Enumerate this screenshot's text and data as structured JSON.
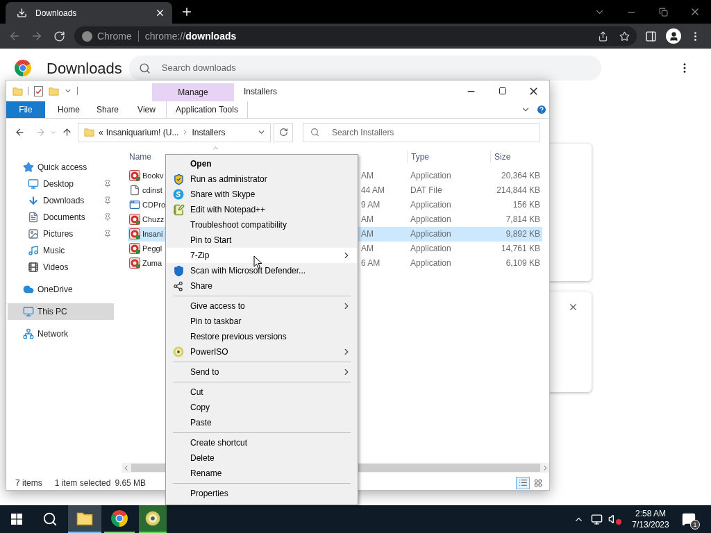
{
  "chrome": {
    "tab": {
      "title": "Downloads"
    },
    "omnibox": {
      "site": "Chrome",
      "url": "chrome://**downloads**"
    }
  },
  "downloads_page": {
    "title": "Downloads",
    "search": {
      "placeholder": "Search downloads"
    },
    "cards": [
      {
        "closable": false
      },
      {
        "closable": true
      }
    ]
  },
  "explorer": {
    "title": "Installers",
    "context_tab": "Manage",
    "ribbon_tabs": [
      {
        "label": "File",
        "kind": "file"
      },
      {
        "label": "Home",
        "kind": "tab"
      },
      {
        "label": "Share",
        "kind": "tab"
      },
      {
        "label": "View",
        "kind": "tab"
      },
      {
        "label": "Application Tools",
        "kind": "context"
      }
    ],
    "address": {
      "overflow": "«",
      "segments": [
        "Insaniquarium! (U...",
        "Installers"
      ]
    },
    "search": {
      "placeholder": "Search Installers"
    },
    "nav": [
      {
        "label": "Quick access",
        "kind": "star",
        "selected": false,
        "children": [
          {
            "label": "Desktop",
            "kind": "desktop",
            "pinned": true,
            "selected": false
          },
          {
            "label": "Downloads",
            "kind": "downloads",
            "pinned": true,
            "selected": false
          },
          {
            "label": "Documents",
            "kind": "documents",
            "pinned": true,
            "selected": false
          },
          {
            "label": "Pictures",
            "kind": "pictures",
            "pinned": true,
            "selected": false
          },
          {
            "label": "Music",
            "kind": "music",
            "pinned": false,
            "selected": false
          },
          {
            "label": "Videos",
            "kind": "videos",
            "pinned": false,
            "selected": false
          }
        ]
      },
      {
        "label": "OneDrive",
        "kind": "cloud",
        "selected": false
      },
      {
        "label": "This PC",
        "kind": "pc",
        "selected": true
      },
      {
        "label": "Network",
        "kind": "network",
        "selected": false
      }
    ],
    "columns": [
      {
        "label": "Name"
      },
      {
        "label": "Type"
      },
      {
        "label": "Size"
      }
    ],
    "files": [
      {
        "kind": "app",
        "name": "Bookv",
        "date": "AM",
        "type": "Application",
        "size": "20,364 KB",
        "selected": false
      },
      {
        "kind": "file",
        "name": "cdinst",
        "date": "44 AM",
        "type": "DAT File",
        "size": "214,844 KB",
        "selected": false
      },
      {
        "kind": "window",
        "name": "CDPro",
        "date": "9 AM",
        "type": "Application",
        "size": "156 KB",
        "selected": false
      },
      {
        "kind": "app",
        "name": "Chuzz",
        "date": "AM",
        "type": "Application",
        "size": "7,814 KB",
        "selected": false
      },
      {
        "kind": "app",
        "name": "Insani",
        "date": "AM",
        "type": "Application",
        "size": "9,892 KB",
        "selected": true
      },
      {
        "kind": "app",
        "name": "Peggl",
        "date": "AM",
        "type": "Application",
        "size": "14,761 KB",
        "selected": false
      },
      {
        "kind": "app",
        "name": "Zuma",
        "date": "6 AM",
        "type": "Application",
        "size": "6,109 KB",
        "selected": false
      }
    ],
    "status": {
      "count": "7 items",
      "selection": "1 item selected",
      "size": "9.65 MB"
    },
    "views": [
      {
        "kind": "details",
        "selected": true
      },
      {
        "kind": "tiles",
        "selected": false
      }
    ]
  },
  "context_menu": {
    "items": [
      {
        "kind": "item",
        "label": "Open",
        "bold": true,
        "submenu": false,
        "selected": false
      },
      {
        "kind": "item",
        "label": "Run as administrator",
        "bold": false,
        "submenu": false,
        "selected": false
      },
      {
        "kind": "item",
        "label": "Share with Skype",
        "bold": false,
        "submenu": false,
        "selected": false
      },
      {
        "kind": "item",
        "label": "Edit with Notepad++",
        "bold": false,
        "submenu": false,
        "selected": false
      },
      {
        "kind": "item",
        "label": "Troubleshoot compatibility",
        "bold": false,
        "submenu": false,
        "selected": false
      },
      {
        "kind": "item",
        "label": "Pin to Start",
        "bold": false,
        "submenu": false,
        "selected": false
      },
      {
        "kind": "item",
        "label": "7-Zip",
        "bold": false,
        "submenu": true,
        "selected": true
      },
      {
        "kind": "item",
        "label": "Scan with Microsoft Defender...",
        "bold": false,
        "submenu": false,
        "selected": false
      },
      {
        "kind": "item",
        "label": "Share",
        "bold": false,
        "submenu": false,
        "selected": false
      },
      {
        "kind": "separator"
      },
      {
        "kind": "item",
        "label": "Give access to",
        "bold": false,
        "submenu": true,
        "selected": false
      },
      {
        "kind": "item",
        "label": "Pin to taskbar",
        "bold": false,
        "submenu": false,
        "selected": false
      },
      {
        "kind": "item",
        "label": "Restore previous versions",
        "bold": false,
        "submenu": false,
        "selected": false
      },
      {
        "kind": "item",
        "label": "PowerISO",
        "bold": false,
        "submenu": true,
        "selected": false
      },
      {
        "kind": "separator"
      },
      {
        "kind": "item",
        "label": "Send to",
        "bold": false,
        "submenu": true,
        "selected": false
      },
      {
        "kind": "separator"
      },
      {
        "kind": "item",
        "label": "Cut",
        "bold": false,
        "submenu": false,
        "selected": false
      },
      {
        "kind": "item",
        "label": "Copy",
        "bold": false,
        "submenu": false,
        "selected": false
      },
      {
        "kind": "item",
        "label": "Paste",
        "bold": false,
        "submenu": false,
        "selected": false
      },
      {
        "kind": "separator"
      },
      {
        "kind": "item",
        "label": "Create shortcut",
        "bold": false,
        "submenu": false,
        "selected": false
      },
      {
        "kind": "item",
        "label": "Delete",
        "bold": false,
        "submenu": false,
        "selected": false
      },
      {
        "kind": "item",
        "label": "Rename",
        "bold": false,
        "submenu": false,
        "selected": false
      },
      {
        "kind": "separator"
      },
      {
        "kind": "item",
        "label": "Properties",
        "bold": false,
        "submenu": false,
        "selected": false
      }
    ]
  },
  "taskbar": {
    "apps": [
      {
        "kind": "explorer",
        "selected": true,
        "flashing": false
      },
      {
        "kind": "chrome",
        "selected": false,
        "flashing": false
      },
      {
        "kind": "disc",
        "selected": false,
        "flashing": true
      }
    ],
    "clock": {
      "time": "2:58 AM",
      "date": "7/13/2023"
    },
    "notifications": "1"
  }
}
